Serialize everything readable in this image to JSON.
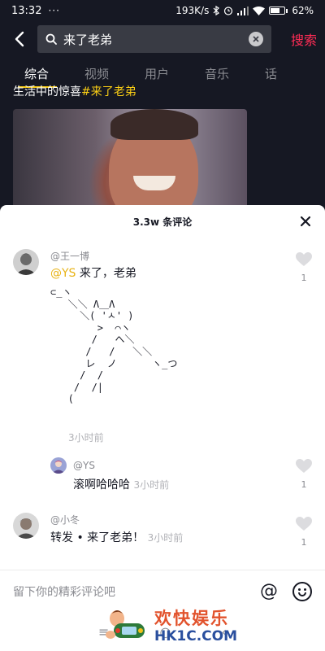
{
  "status_bar": {
    "time": "13:32",
    "dots": "···",
    "network_speed": "193K/s",
    "battery": "62%",
    "battery_level": 0.62
  },
  "search": {
    "query": "来了老弟",
    "submit_label": "搜索"
  },
  "tabs": [
    {
      "label": "综合",
      "active": true
    },
    {
      "label": "视频",
      "active": false
    },
    {
      "label": "用户",
      "active": false
    },
    {
      "label": "音乐",
      "active": false
    },
    {
      "label": "话",
      "active": false
    }
  ],
  "video": {
    "caption_prefix": "生活中的惊喜",
    "caption_highlight": "#来了老弟"
  },
  "comments_sheet": {
    "title": "3.3w 条评论",
    "comments": [
      {
        "author": "@王一博",
        "mention": "@YS",
        "text": " 来了，老弟",
        "ascii_art": "⊂_ヽ\n   ＼＼ Λ＿Λ\n     ＼( 'ㅅ' )\n        >  ⌒ヽ\n       /   へ＼\n      /   /   ＼＼\n      レ  ノ      ヽ_つ\n     /  /\n    /  /|\n   (",
        "time": "3小时前",
        "likes": "1",
        "reply": {
          "author": "@YS",
          "text": "滚啊哈哈哈",
          "time": "3小时前",
          "likes": "1"
        }
      },
      {
        "author": "@小冬",
        "text": "转发 • 来了老弟！",
        "time": "3小时前",
        "likes": "1"
      }
    ]
  },
  "input_bar": {
    "placeholder": "留下你的精彩评论吧",
    "at_symbol": "@"
  },
  "navbar": {
    "menu": "≡",
    "home": "○",
    "back": "‹"
  },
  "watermark": {
    "chinese": "欢快娱乐",
    "domain": "HK1C.COM"
  },
  "colors": {
    "accent": "#fe2c55",
    "highlight": "#face15",
    "background": "#161823"
  }
}
